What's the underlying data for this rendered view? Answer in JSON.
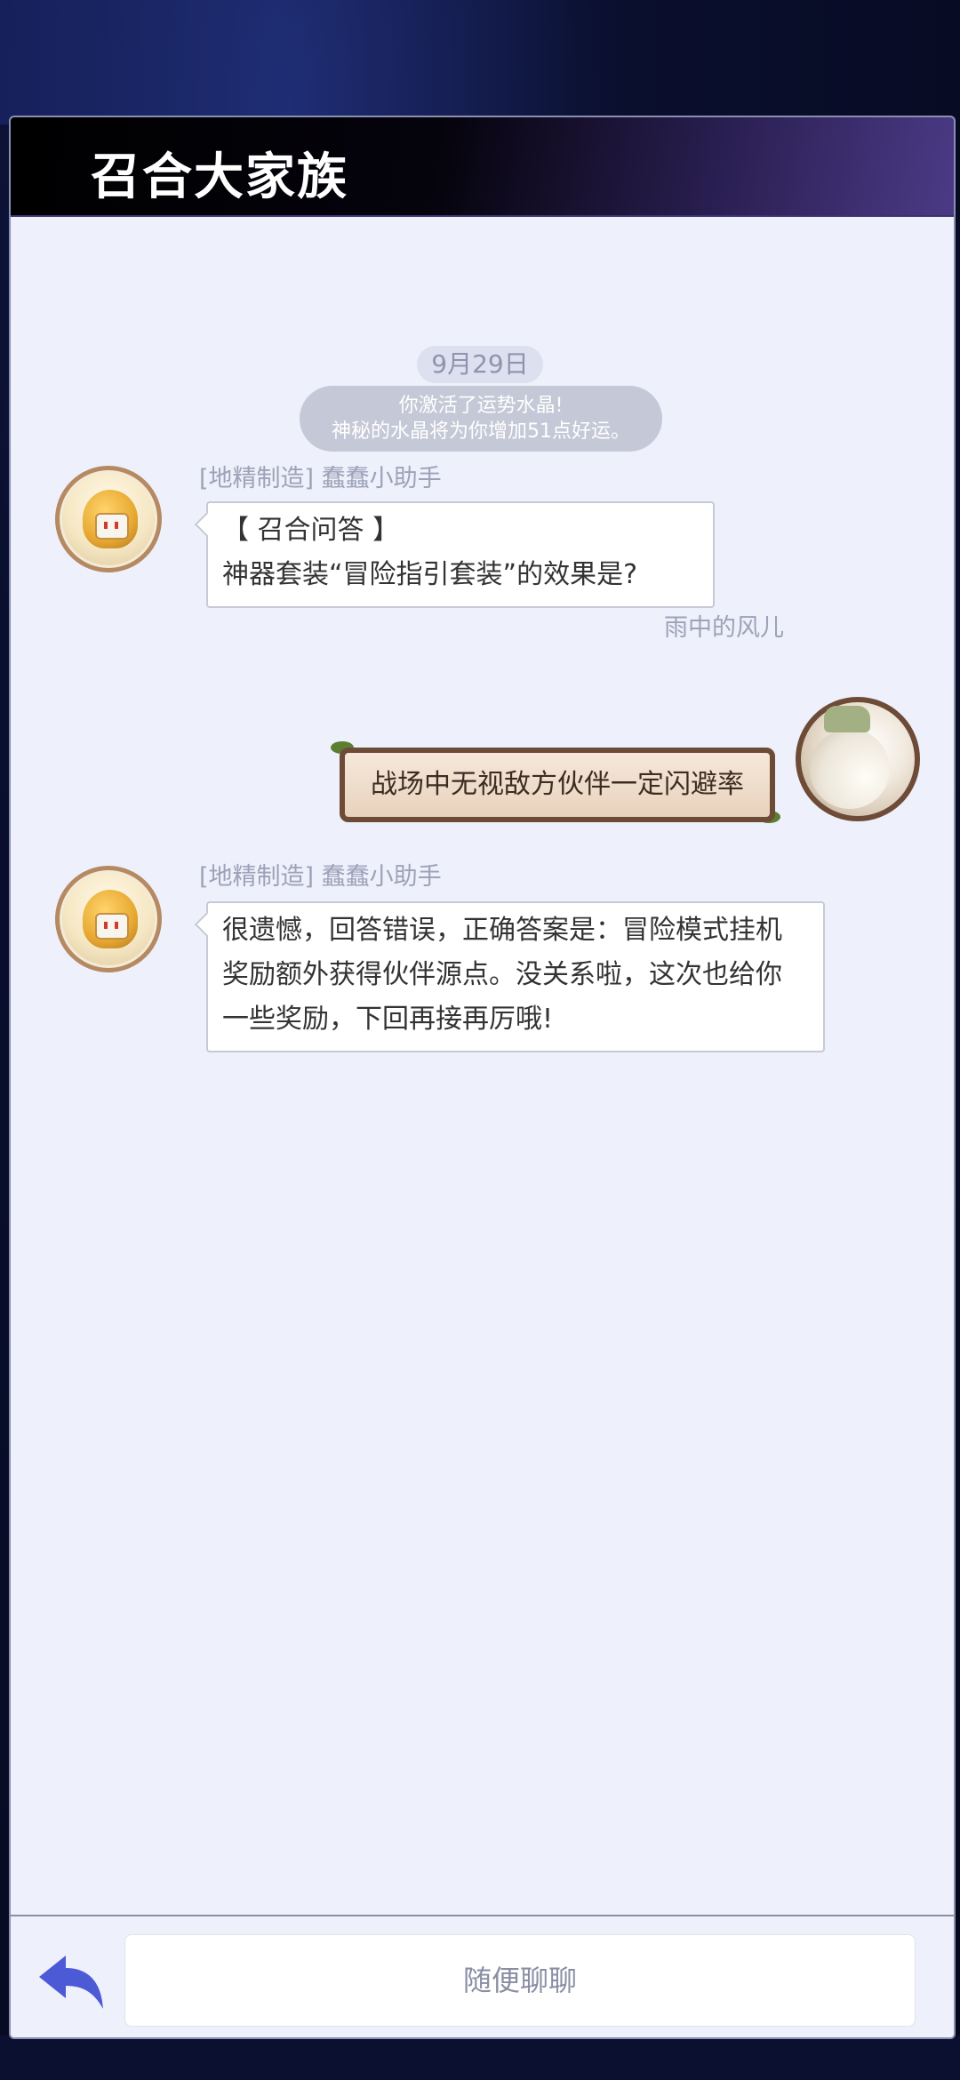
{
  "header": {
    "title": "召合大家族"
  },
  "chat": {
    "date": "9月29日",
    "system_message": {
      "line1": "你激活了运势水晶!",
      "line2": "神秘的水晶将为你增加51点好运。"
    },
    "messages": [
      {
        "sender": "[地精制造] 蠢蠢小助手",
        "avatar_icon": "goblin-robot-avatar",
        "lines": [
          "【 召合问答 】",
          "神器套装“冒险指引套装”的效果是?"
        ]
      },
      {
        "sender": "雨中的风儿",
        "avatar_icon": "anime-girl-avatar",
        "text": "战场中无视敌方伙伴一定闪避率"
      },
      {
        "sender": "[地精制造] 蠢蠢小助手",
        "avatar_icon": "goblin-robot-avatar",
        "lines": [
          "很遗憾，回答错误，正确答案是：冒险模式挂机",
          "奖励额外获得伙伴源点。没关系啦，这次也给你",
          "一些奖励，下回再接再厉哦!"
        ]
      }
    ]
  },
  "footer": {
    "back_icon": "back-arrow-icon",
    "input_placeholder": "随便聊聊"
  },
  "colors": {
    "panel_bg": "#eef0fb",
    "back_arrow": "#4d5ad6",
    "user_bubble_border": "#6d4b37"
  }
}
